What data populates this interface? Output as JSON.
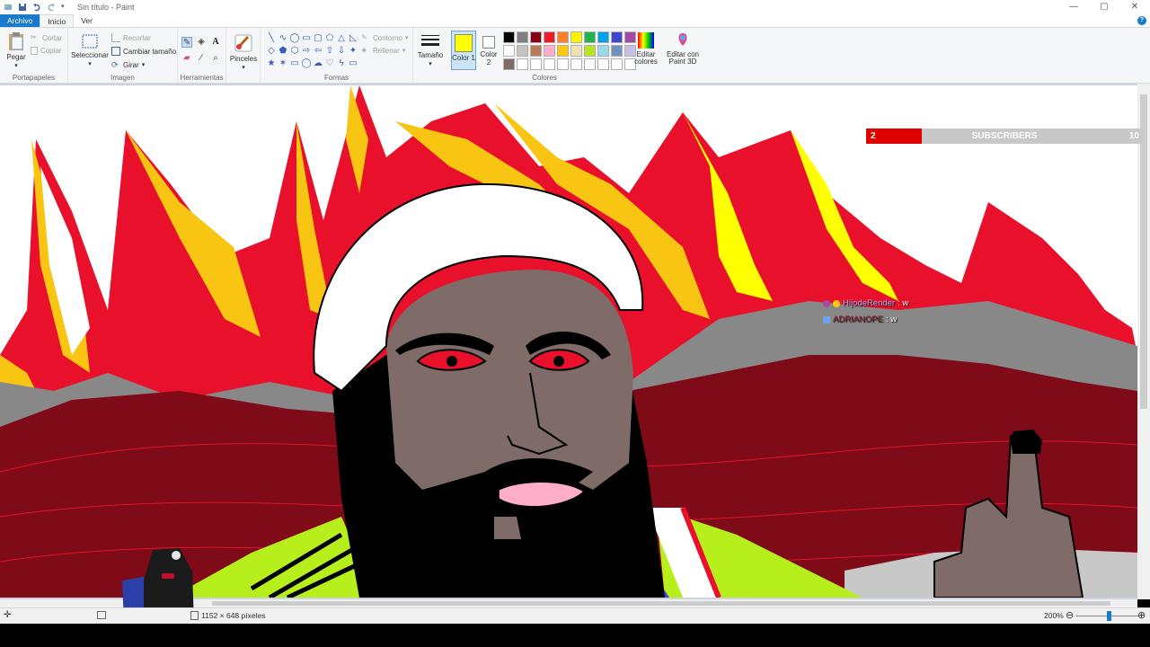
{
  "window": {
    "title": "Sin título - Paint"
  },
  "tabs": {
    "file": "Archivo",
    "home": "Inicio",
    "view": "Ver"
  },
  "clipboard": {
    "paste": "Pegar",
    "cut": "Cortar",
    "copy": "Copiar",
    "group": "Portapapeles"
  },
  "image": {
    "select": "Seleccionar",
    "crop": "Recortar",
    "resize": "Cambiar tamaño",
    "rotate": "Girar",
    "group": "Imagen"
  },
  "tools": {
    "group": "Herramientas"
  },
  "brushes": {
    "label": "Pinceles"
  },
  "shapes": {
    "outline": "Contorno",
    "fill": "Rellenar",
    "group": "Formas"
  },
  "size": {
    "label": "Tamaño"
  },
  "colors": {
    "color1": "Color 1",
    "color2": "Color 2",
    "color1_value": "#ffff00",
    "color2_value": "#ffffff",
    "edit": "Editar colores",
    "paint3d": "Editar con Paint 3D",
    "group": "Colores",
    "palette_row1": [
      "#000000",
      "#7f7f7f",
      "#880015",
      "#ed1c24",
      "#ff7f27",
      "#fff200",
      "#22b14c",
      "#00a2e8",
      "#3f48cc",
      "#a349a4"
    ],
    "palette_row2": [
      "#ffffff",
      "#c3c3c3",
      "#b97a57",
      "#ffaec9",
      "#ffc90e",
      "#efe4b0",
      "#b5e61d",
      "#99d9ea",
      "#7092be",
      "#c8bfe7"
    ],
    "palette_row3": [
      "#7f6b68",
      "#ffffff",
      "#ffffff",
      "#ffffff",
      "#ffffff",
      "#ffffff",
      "#ffffff",
      "#ffffff",
      "#ffffff",
      "#ffffff"
    ]
  },
  "overlay": {
    "subs_current": "2",
    "subs_label": "SUBSCRIBERS",
    "subs_goal": "10",
    "subs_progress": 0.2,
    "chat": [
      {
        "user": "HijodeRender",
        "message": ": w"
      },
      {
        "user": "ADRIANOPE",
        "message": ": w"
      }
    ]
  },
  "status": {
    "dimensions": "1152 × 648 píxeles",
    "zoom": "200%"
  }
}
